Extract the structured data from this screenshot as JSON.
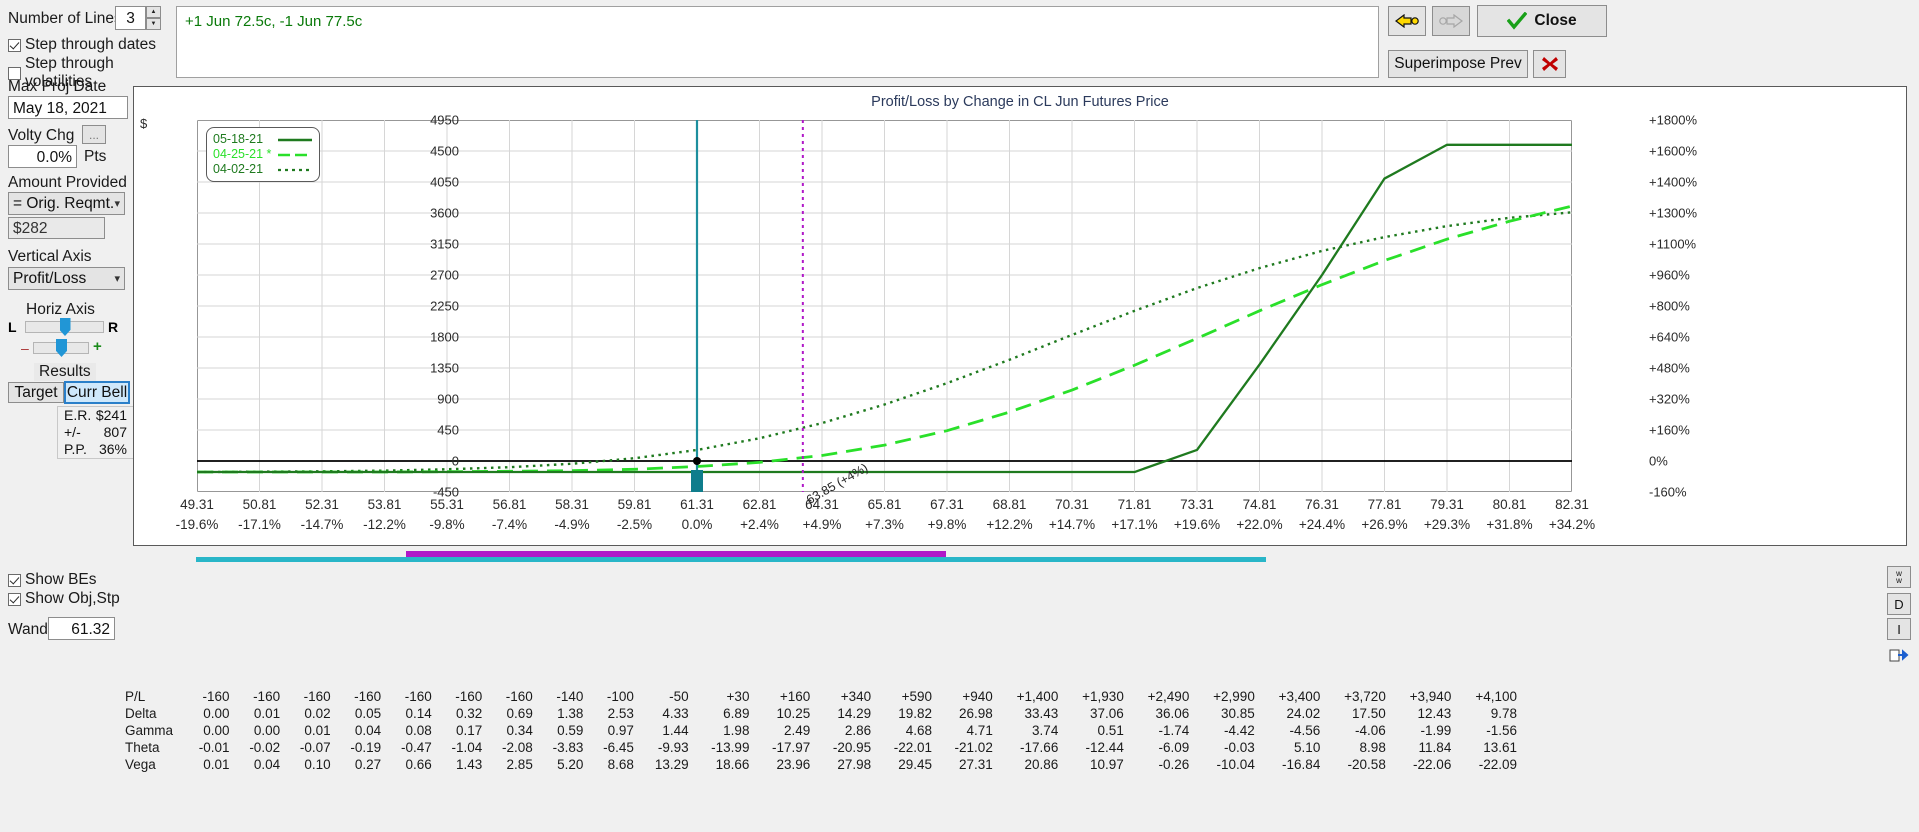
{
  "left_panel": {
    "number_of_lines_label": "Number of Lines",
    "number_of_lines_value": "3",
    "step_dates_label": "Step through dates",
    "step_dates_checked": true,
    "step_vol_label": "Step through volatilities",
    "step_vol_checked": false,
    "max_proj_date_label": "Max Proj Date",
    "max_proj_date_value": "May 18, 2021",
    "volty_chg_label": "Volty Chg",
    "volty_ellipsis": "...",
    "volty_chg_value": "0.0%",
    "pts_label": "Pts",
    "amount_provided_label": "Amount Provided",
    "amount_provided_value": "= Orig. Reqmt.",
    "amount_value": "$282",
    "vertical_axis_label": "Vertical Axis",
    "vertical_axis_value": "Profit/Loss",
    "horiz_axis_label": "Horiz Axis",
    "horiz_left": "L",
    "horiz_right": "R",
    "zoom_minus": "–",
    "zoom_plus": "+",
    "results_label": "Results",
    "target_tab": "Target",
    "curr_bell_tab": "Curr Bell",
    "results": [
      {
        "key": "E.R.",
        "value": "$241"
      },
      {
        "key": "+/-",
        "value": "807"
      },
      {
        "key": "P.P.",
        "value": "36%"
      }
    ],
    "show_bes_label": "Show BEs",
    "show_bes_checked": true,
    "show_objstp_label": "Show Obj,Stp",
    "show_objstp_checked": true,
    "wand_label": "Wand",
    "wand_value": "61.32"
  },
  "toolbar": {
    "position_text": "+1 Jun 72.5c, -1 Jun 77.5c",
    "back_icon": "left-arrow-icon",
    "forward_icon": "right-arrow-icon",
    "close_label": "Close",
    "close_icon": "check-icon",
    "superimpose_label": "Superimpose Prev",
    "delete_icon": "red-x-icon"
  },
  "side_buttons": [
    {
      "name": "w-button",
      "label": "w\nw"
    },
    {
      "name": "d-button",
      "label": "D"
    },
    {
      "name": "i-button",
      "label": "I"
    },
    {
      "name": "export-button",
      "label": "⮕"
    }
  ],
  "chart_data": {
    "type": "line",
    "title": "Profit/Loss by Change in CL Jun Futures Price",
    "ylabel": "$",
    "xlabel": "",
    "legend_position": "top-left",
    "grid": true,
    "legend": [
      {
        "label": "05-18-21",
        "style": "solid",
        "color": "#1f7a1f"
      },
      {
        "label": "04-25-21 *",
        "style": "dashed",
        "color": "#2ae02a"
      },
      {
        "label": "04-02-21",
        "style": "dotted",
        "color": "#1f7a1f"
      }
    ],
    "y_ticks": [
      "4950",
      "4500",
      "4050",
      "3600",
      "3150",
      "2700",
      "2250",
      "1800",
      "1350",
      "900",
      "450",
      "0",
      "-450"
    ],
    "y_ticks_right": [
      "+1800%",
      "+1600%",
      "+1400%",
      "+1300%",
      "+1100%",
      "+960%",
      "+800%",
      "+640%",
      "+480%",
      "+320%",
      "+160%",
      "0%",
      "-160%"
    ],
    "ylim": [
      -450,
      4950
    ],
    "x_ticks": [
      "49.31",
      "50.81",
      "52.31",
      "53.81",
      "55.31",
      "56.81",
      "58.31",
      "59.81",
      "61.31",
      "62.81",
      "64.31",
      "65.81",
      "67.31",
      "68.81",
      "70.31",
      "71.81",
      "73.31",
      "74.81",
      "76.31",
      "77.81",
      "79.31",
      "80.81",
      "82.31"
    ],
    "x_ticks_pct": [
      "-19.6%",
      "-17.1%",
      "-14.7%",
      "-12.2%",
      "-9.8%",
      "-7.4%",
      "-4.9%",
      "-2.5%",
      "0.0%",
      "+2.4%",
      "+4.9%",
      "+7.3%",
      "+9.8%",
      "+12.2%",
      "+14.7%",
      "+17.1%",
      "+19.6%",
      "+22.0%",
      "+24.4%",
      "+26.9%",
      "+29.3%",
      "+31.8%",
      "+34.2%"
    ],
    "annotation": "63.85 (+4%)",
    "current_price_marker": "61.31",
    "breakeven_marker": "63.85",
    "series": [
      {
        "name": "05-18-21",
        "style": "solid",
        "color": "#1f7a1f",
        "values": [
          -160,
          -160,
          -160,
          -160,
          -160,
          -160,
          -160,
          -160,
          -160,
          -160,
          -160,
          -160,
          -160,
          -160,
          -160,
          -160,
          160,
          1400,
          2700,
          4100,
          4590,
          4590,
          4590
        ]
      },
      {
        "name": "04-25-21 *",
        "style": "dashed",
        "color": "#2ae02a",
        "values": [
          -160,
          -160,
          -160,
          -160,
          -155,
          -150,
          -140,
          -120,
          -80,
          -20,
          80,
          230,
          440,
          710,
          1030,
          1390,
          1780,
          2180,
          2560,
          2910,
          3220,
          3480,
          3700
        ]
      },
      {
        "name": "04-02-21",
        "style": "dotted",
        "color": "#1f7a1f",
        "values": [
          -160,
          -155,
          -150,
          -140,
          -120,
          -90,
          -40,
          40,
          160,
          330,
          550,
          820,
          1130,
          1470,
          1830,
          2180,
          2510,
          2800,
          3050,
          3250,
          3410,
          3530,
          3610
        ]
      }
    ]
  },
  "greeks_table": {
    "rows": [
      {
        "label": "P/L",
        "values": [
          "-160",
          "-160",
          "-160",
          "-160",
          "-160",
          "-160",
          "-160",
          "-140",
          "-100",
          "-50",
          "+30",
          "+160",
          "+340",
          "+590",
          "+940",
          "+1,400",
          "+1,930",
          "+2,490",
          "+2,990",
          "+3,400",
          "+3,720",
          "+3,940",
          "+4,100"
        ]
      },
      {
        "label": "Delta",
        "values": [
          "0.00",
          "0.01",
          "0.02",
          "0.05",
          "0.14",
          "0.32",
          "0.69",
          "1.38",
          "2.53",
          "4.33",
          "6.89",
          "10.25",
          "14.29",
          "19.82",
          "26.98",
          "33.43",
          "37.06",
          "36.06",
          "30.85",
          "24.02",
          "17.50",
          "12.43",
          "9.78"
        ]
      },
      {
        "label": "Gamma",
        "values": [
          "0.00",
          "0.00",
          "0.01",
          "0.04",
          "0.08",
          "0.17",
          "0.34",
          "0.59",
          "0.97",
          "1.44",
          "1.98",
          "2.49",
          "2.86",
          "4.68",
          "4.71",
          "3.74",
          "0.51",
          "-1.74",
          "-4.42",
          "-4.56",
          "-4.06",
          "-1.99",
          "-1.56"
        ]
      },
      {
        "label": "Theta",
        "values": [
          "-0.01",
          "-0.02",
          "-0.07",
          "-0.19",
          "-0.47",
          "-1.04",
          "-2.08",
          "-3.83",
          "-6.45",
          "-9.93",
          "-13.99",
          "-17.97",
          "-20.95",
          "-22.01",
          "-21.02",
          "-17.66",
          "-12.44",
          "-6.09",
          "-0.03",
          "5.10",
          "8.98",
          "11.84",
          "13.61"
        ]
      },
      {
        "label": "Vega",
        "values": [
          "0.01",
          "0.04",
          "0.10",
          "0.27",
          "0.66",
          "1.43",
          "2.85",
          "5.20",
          "8.68",
          "13.29",
          "18.66",
          "23.96",
          "27.98",
          "29.45",
          "27.31",
          "20.86",
          "10.97",
          "-0.26",
          "-10.04",
          "-16.84",
          "-20.58",
          "-22.06",
          "-22.09"
        ]
      }
    ]
  }
}
